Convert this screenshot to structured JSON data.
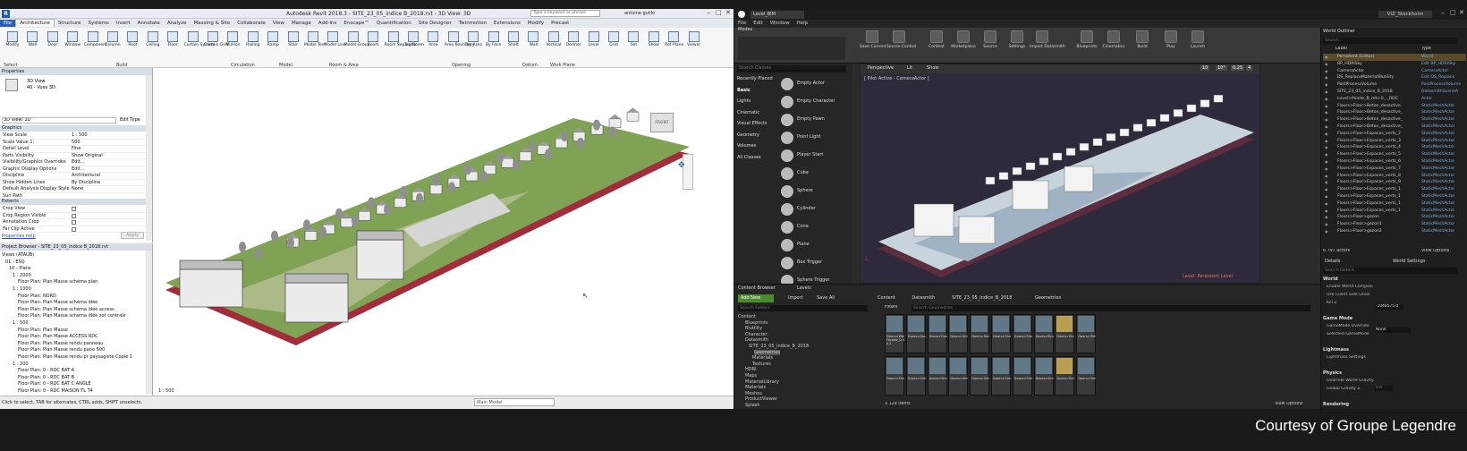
{
  "revit": {
    "title": "Autodesk Revit 2018.3 - SITE_23_05_indice B_2018.rvt - 3D View: 3D",
    "search_placeholder": "Type a keyword or phrase",
    "user": "antoine.guillo",
    "tabs": [
      "File",
      "Architecture",
      "Structure",
      "Systems",
      "Insert",
      "Annotate",
      "Analyze",
      "Massing & Site",
      "Collaborate",
      "View",
      "Manage",
      "Add-Ins",
      "Enscape™",
      "Quantification",
      "Site Designer",
      "Twinmotion",
      "Extensions",
      "Modify",
      "Precast"
    ],
    "active_tab": "Architecture",
    "tools": [
      "Modify",
      "Wall",
      "Door",
      "Window",
      "Component",
      "Column",
      "Roof",
      "Ceiling",
      "Floor",
      "Curtain System",
      "Curtain Grid",
      "Mullion",
      "Railing",
      "Ramp",
      "Stair",
      "Model Text",
      "Model Line",
      "Model Group",
      "Room",
      "Room Separator",
      "Tag Room",
      "Area",
      "Area Boundary",
      "Tag Area",
      "By Face",
      "Shaft",
      "Wall",
      "Vertical",
      "Dormer",
      "Level",
      "Grid",
      "Set",
      "Show",
      "Ref Plane",
      "Viewer"
    ],
    "groups": [
      "Select",
      "Build",
      "Circulation",
      "Model",
      "Room & Area",
      "Opening",
      "Datum",
      "Work Plane"
    ],
    "properties": {
      "header": "Properties",
      "type_name": "3D View",
      "type_sub": "40 - Vues 3D",
      "selector": "3D View: 3D",
      "edit_type": "Edit Type",
      "section_graphics": "Graphics",
      "rows": [
        {
          "k": "View Scale",
          "v": "1 : 500"
        },
        {
          "k": "Scale Value    1:",
          "v": "500"
        },
        {
          "k": "Detail Level",
          "v": "Fine"
        },
        {
          "k": "Parts Visibility",
          "v": "Show Original"
        },
        {
          "k": "Visibility/Graphics Overrides",
          "v": "Edit..."
        },
        {
          "k": "Graphic Display Options",
          "v": "Edit..."
        },
        {
          "k": "Discipline",
          "v": "Architectural"
        },
        {
          "k": "Show Hidden Lines",
          "v": "By Discipline"
        },
        {
          "k": "Default Analysis Display Style",
          "v": "None"
        },
        {
          "k": "Sun Path",
          "v": ""
        }
      ],
      "section_extents": "Extents",
      "extent_rows": [
        "Crop View",
        "Crop Region Visible",
        "Annotation Crop",
        "Far Clip Active"
      ],
      "help": "Properties help",
      "apply": "Apply"
    },
    "browser": {
      "header": "Project Browser - SITE_23_05_indice B_2018.rvt",
      "items": [
        "Views (ATAUB)",
        "01 - ESQ",
        "10 - Plans",
        "1 : 2000",
        "Floor Plan: Plan Masse schéma plan",
        "1 : 1000",
        "Floor Plan: NORD",
        "Floor Plan: Plan Masse schéma idée",
        "Floor Plan: Plan Masse schéma idée access",
        "Floor Plan: Plan Masse schéma idée zot centrale",
        "1 : 500",
        "Floor Plan: Plan Masse",
        "Floor Plan: Plan Masse ACCESS RDC",
        "Floor Plan: Plan Masse rendu panneau",
        "Floor Plan: Plan Masse rendu pano 500",
        "Floor Plan: Plan Masse rendu pr paysagiste Copie 1",
        "1 : 200",
        "Floor Plan: 0 - RDC BAT A",
        "Floor Plan: 0 - RDC BAT B",
        "Floor Plan: 0 - RDC BAT C ANGLE",
        "Floor Plan: 0 - RDC MAISON TL T4"
      ]
    },
    "view_scale": "1 : 500",
    "status": "Click to select, TAB for alternates, CTRL adds, SHIFT unselects.",
    "model": "Main Model",
    "viewcube": "FRONT"
  },
  "unreal": {
    "tab": "Level_BIM",
    "project": "VIZ_Stockholm",
    "menu": [
      "File",
      "Edit",
      "Window",
      "Help"
    ],
    "modes_tab": "Modes",
    "toolbar": [
      "Save Current",
      "Source Control",
      "Content",
      "Marketplace",
      "Source",
      "Settings",
      "Import Datasmith",
      "Blueprints",
      "Cinematics",
      "Build",
      "Play",
      "Launch"
    ],
    "search_classes": "Search Classes",
    "categories": [
      "Recently Placed",
      "Basic",
      "Lights",
      "Cinematic",
      "Visual Effects",
      "Geometry",
      "Volumes",
      "All Classes"
    ],
    "placeables": [
      "Empty Actor",
      "Empty Character",
      "Empty Pawn",
      "Point Light",
      "Player Start",
      "Cube",
      "Sphere",
      "Cylinder",
      "Cone",
      "Plane",
      "Box Trigger",
      "Sphere Trigger"
    ],
    "viewport": {
      "perspective": "Perspective",
      "lit": "Lit",
      "show": "Show",
      "pilot": "[ Pilot Active - CameraActor ]",
      "level": "Level: Persistent Level",
      "snap_values": [
        "10",
        "10°",
        "0.25",
        "4"
      ]
    },
    "outliner": {
      "tab": "World Outliner",
      "search": "Search...",
      "col_label": "Label",
      "col_type": "Type",
      "rows": [
        {
          "a": "Persistent (Editor)",
          "b": "World"
        },
        {
          "a": "BP_HDRISky",
          "b": "Edit BP_HDRISky"
        },
        {
          "a": "CameraActor",
          "b": "CameraActor"
        },
        {
          "a": "DS_ReplaceMaterialBlutility",
          "b": "Edit DS_Replace"
        },
        {
          "a": "PostProcessVolume",
          "b": "PostProcessVolume"
        },
        {
          "a": "SITE_23_05_indice_B_2018",
          "b": "DatasmithSceneA"
        },
        {
          "a": "Level>Pointe_B_mtn-0_-_RDC",
          "b": "Actor"
        },
        {
          "a": "Floors>Floor>Beton_desactive",
          "b": "StaticMeshActor"
        },
        {
          "a": "Floors>Floor>Beton_desactive_",
          "b": "StaticMeshActor"
        },
        {
          "a": "Floors>Floor>Beton_desactive_",
          "b": "StaticMeshActor"
        },
        {
          "a": "Floors>Floor>Beton_desactive_",
          "b": "StaticMeshActor"
        },
        {
          "a": "Floors>Floor>Espaces_verts_2",
          "b": "StaticMeshActor"
        },
        {
          "a": "Floors>Floor>Espaces_verts_3",
          "b": "StaticMeshActor"
        },
        {
          "a": "Floors>Floor>Espaces_verts_4",
          "b": "StaticMeshActor"
        },
        {
          "a": "Floors>Floor>Espaces_verts_5",
          "b": "StaticMeshActor"
        },
        {
          "a": "Floors>Floor>Espaces_verts_6",
          "b": "StaticMeshActor"
        },
        {
          "a": "Floors>Floor>Espaces_verts_7",
          "b": "StaticMeshActor"
        },
        {
          "a": "Floors>Floor>Espaces_verts_8",
          "b": "StaticMeshActor"
        },
        {
          "a": "Floors>Floor>Espaces_verts_9",
          "b": "StaticMeshActor"
        },
        {
          "a": "Floors>Floor>Espaces_verts_1",
          "b": "StaticMeshActor"
        },
        {
          "a": "Floors>Floor>Espaces_verts_1",
          "b": "StaticMeshActor"
        },
        {
          "a": "Floors>Floor>Espaces_verts_1",
          "b": "StaticMeshActor"
        },
        {
          "a": "Floors>Floor>Espaces_verts_1",
          "b": "StaticMeshActor"
        },
        {
          "a": "Floors>Floor>gazon",
          "b": "StaticMeshActor"
        },
        {
          "a": "Floors>Floor>gazon1",
          "b": "StaticMeshActor"
        },
        {
          "a": "Floors>Floor>gazon2",
          "b": "StaticMeshActor"
        }
      ],
      "actors": "6 797 actors",
      "view_options": "View Options"
    },
    "details": {
      "tab1": "Details",
      "tab2": "World Settings",
      "search": "Search Details",
      "sections": [
        {
          "h": "World",
          "rows": [
            "Enable World Composi",
            "Use Client Side Level",
            "Kill Z"
          ]
        },
        {
          "h": "Game Mode",
          "rows": [
            "GameMode Override",
            "Selected GameMode"
          ]
        },
        {
          "h": "Lightmass",
          "rows": [
            "Lightmass Settings"
          ]
        },
        {
          "h": "Physics",
          "rows": [
            "Override World Gravity",
            "Global Gravity Z"
          ]
        },
        {
          "h": "Rendering",
          "rows": []
        }
      ],
      "kill_z": "-1048575.0",
      "game_mode": "None",
      "gravity": "0.0"
    },
    "content": {
      "tab1": "Content Browser",
      "tab2": "Levels",
      "add_new": "Add New",
      "import": "Import",
      "save_all": "Save All",
      "path": [
        "Content",
        "Datasmith",
        "SITE_23_05_indice_B_2018",
        "Geometries"
      ],
      "search_folders": "Search Folders",
      "filters": "Filters",
      "search_geometries": "Search Geometries",
      "folders": [
        "Content",
        "Blueprints",
        "Blutility",
        "Character",
        "Datasmith",
        "SITE_23_05_indice_B_2018",
        "Geometries",
        "Materials",
        "Textures",
        "HDRI",
        "Maps",
        "MaterialLibrary",
        "Materials",
        "Meshes",
        "ProductViewer",
        "Splash"
      ],
      "items_count": "3 129 items",
      "view_options": "View Options",
      "asset_names": [
        "Doors>Wall Facade_0.9m x 2",
        "Doors>Double_ouverture",
        "Doors>Double_ouverture",
        "Doors>Simple_ouverture",
        "Doors>Simple_ouverture",
        "Doors>Simple_ouverture",
        "Doors>Simple_ouverture",
        "Doors>Simple_ouverture",
        "Doors>Simple_ouverture",
        "Doors>Simple_ouverture",
        "Doors>Simple_ouverture",
        "Doors>Simple_ouverture",
        "Doors>Simple_ouverture",
        "Doors>Simple_ouverture",
        "Doors>Simple_ouverture",
        "Doors>Simple_ouverture",
        "Doors>Simple_ouverture",
        "Doors>Simple_ouverture",
        "Doors>Simple_ouverture",
        "Doors>Simple_ouverture"
      ]
    }
  },
  "credit": "Courtesy of Groupe Legendre"
}
